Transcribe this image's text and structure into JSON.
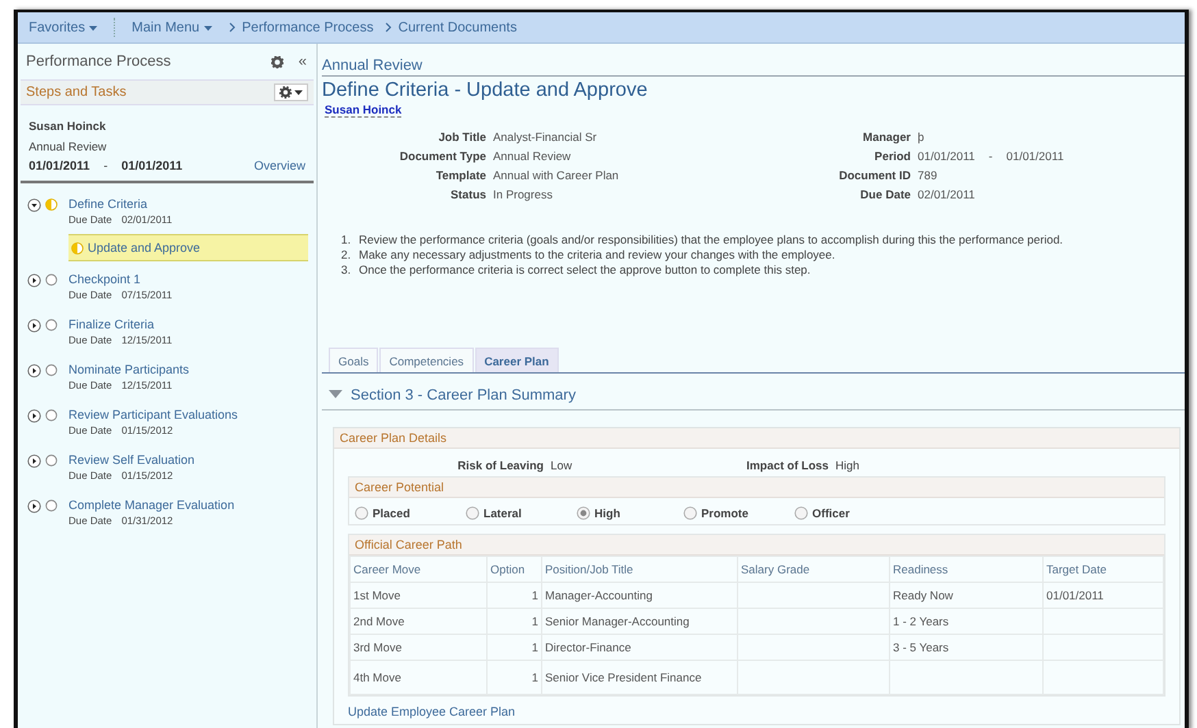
{
  "nav": {
    "items": [
      {
        "label": "Favorites",
        "kind": "menu"
      },
      {
        "label": "Main Menu",
        "kind": "menu"
      },
      {
        "label": "Performance Process",
        "kind": "crumb"
      },
      {
        "label": "Current Documents",
        "kind": "crumb"
      }
    ]
  },
  "sidebar": {
    "title": "Performance Process",
    "collapse": "«",
    "steps_header": "Steps and Tasks",
    "employee": {
      "name": "Susan Hoinck",
      "document": "Annual Review",
      "start": "01/01/2011",
      "separator": "-",
      "end": "01/01/2011",
      "overview": "Overview"
    },
    "steps": [
      {
        "title": "Define Criteria",
        "due_label": "Due Date",
        "due": "02/01/2011",
        "started": true,
        "expanded": true,
        "tasks": [
          {
            "label": "Update and Approve",
            "started": true,
            "selected": true
          }
        ]
      },
      {
        "title": "Checkpoint 1",
        "due_label": "Due Date",
        "due": "07/15/2011",
        "started": false,
        "expanded": false
      },
      {
        "title": "Finalize Criteria",
        "due_label": "Due Date",
        "due": "12/15/2011",
        "started": false,
        "expanded": false
      },
      {
        "title": "Nominate Participants",
        "due_label": "Due Date",
        "due": "12/15/2011",
        "started": false,
        "expanded": false
      },
      {
        "title": "Review Participant Evaluations",
        "due_label": "Due Date",
        "due": "01/15/2012",
        "started": false,
        "expanded": false
      },
      {
        "title": "Review Self Evaluation",
        "due_label": "Due Date",
        "due": "01/15/2012",
        "started": false,
        "expanded": false
      },
      {
        "title": "Complete Manager Evaluation",
        "due_label": "Due Date",
        "due": "01/31/2012",
        "started": false,
        "expanded": false
      }
    ]
  },
  "content": {
    "breadcrumb": "Annual Review",
    "title": "Define Criteria - Update and Approve",
    "employee_link": "Susan Hoinck",
    "fields_left": [
      {
        "label": "Job Title",
        "value": "Analyst-Financial Sr"
      },
      {
        "label": "Document Type",
        "value": "Annual Review"
      },
      {
        "label": "Template",
        "value": "Annual with Career Plan"
      },
      {
        "label": "Status",
        "value": "In Progress"
      }
    ],
    "fields_right": [
      {
        "label": "Manager",
        "value": "þ"
      },
      {
        "label": "Period",
        "value": "01/01/2011",
        "separator": "-",
        "value_end": "01/01/2011"
      },
      {
        "label": "Document ID",
        "value": "789"
      },
      {
        "label": "Due Date",
        "value": "02/01/2011"
      }
    ],
    "instructions": [
      {
        "number": "1.",
        "text": "Review the performance criteria (goals and/or responsibilities) that the employee plans to accomplish during this the performance period."
      },
      {
        "number": "2.",
        "text": "Make any necessary adjustments to the criteria and review your changes with the employee."
      },
      {
        "number": "3.",
        "text": "Once the performance criteria is correct select the approve button to complete this step."
      }
    ],
    "tabs": [
      {
        "label": "Goals",
        "selected": false
      },
      {
        "label": "Competencies",
        "selected": false
      },
      {
        "label": "Career Plan",
        "selected": true
      }
    ],
    "section": {
      "title": "Section 3 - Career Plan Summary",
      "expanded": true,
      "details": {
        "title": "Career Plan Details",
        "risk_label": "Risk of Leaving",
        "risk_value": "Low",
        "impact_label": "Impact of Loss",
        "impact_value": "High",
        "potential": {
          "title": "Career Potential",
          "options": [
            {
              "label": "Placed",
              "selected": false
            },
            {
              "label": "Lateral",
              "selected": false
            },
            {
              "label": "High",
              "selected": true
            },
            {
              "label": "Promote",
              "selected": false
            },
            {
              "label": "Officer",
              "selected": false
            }
          ]
        },
        "path": {
          "title": "Official Career Path",
          "columns": [
            "Career Move",
            "Option",
            "Position/Job Title",
            "Salary Grade",
            "Readiness",
            "Target Date"
          ],
          "rows": [
            [
              "1st Move",
              "1",
              "Manager-Accounting",
              "",
              "Ready Now",
              "01/01/2011"
            ],
            [
              "2nd Move",
              "1",
              "Senior Manager-Accounting",
              "",
              "1 - 2 Years",
              ""
            ],
            [
              "3rd Move",
              "1",
              "Director-Finance",
              "",
              "3 - 5 Years",
              ""
            ],
            [
              "4th Move",
              "1",
              "Senior Vice President Finance",
              "",
              "",
              ""
            ]
          ]
        },
        "link": "Update Employee Career Plan"
      }
    }
  }
}
